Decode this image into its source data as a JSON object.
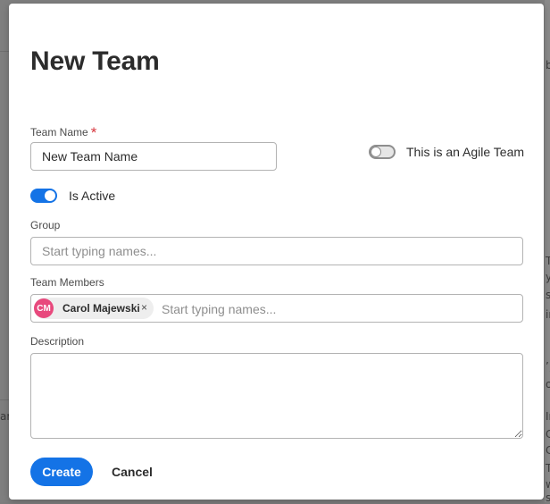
{
  "background": {
    "fragments_right": [
      "b",
      "Th",
      "yn",
      "sil",
      "in",
      "’,",
      "oc",
      "In",
      "C",
      "C",
      "T",
      "w",
      "st"
    ],
    "fragment_left": "ar"
  },
  "dialog": {
    "title": "New Team",
    "team_name": {
      "label": "Team Name",
      "required_mark": "*",
      "value": "New Team Name"
    },
    "agile_toggle": {
      "label": "This is an Agile Team",
      "checked": false
    },
    "active_toggle": {
      "label": "Is Active",
      "checked": true
    },
    "group": {
      "label": "Group",
      "placeholder": "Start typing names..."
    },
    "team_members": {
      "label": "Team Members",
      "placeholder": "Start typing names...",
      "members": [
        {
          "initials": "CM",
          "name": "Carol Majewski",
          "remove_glyph": "×",
          "avatar_color": "#e8497d"
        }
      ]
    },
    "description": {
      "label": "Description",
      "value": ""
    },
    "buttons": {
      "create": "Create",
      "cancel": "Cancel"
    }
  },
  "colors": {
    "accent": "#1473e6",
    "required": "#d7373f"
  }
}
